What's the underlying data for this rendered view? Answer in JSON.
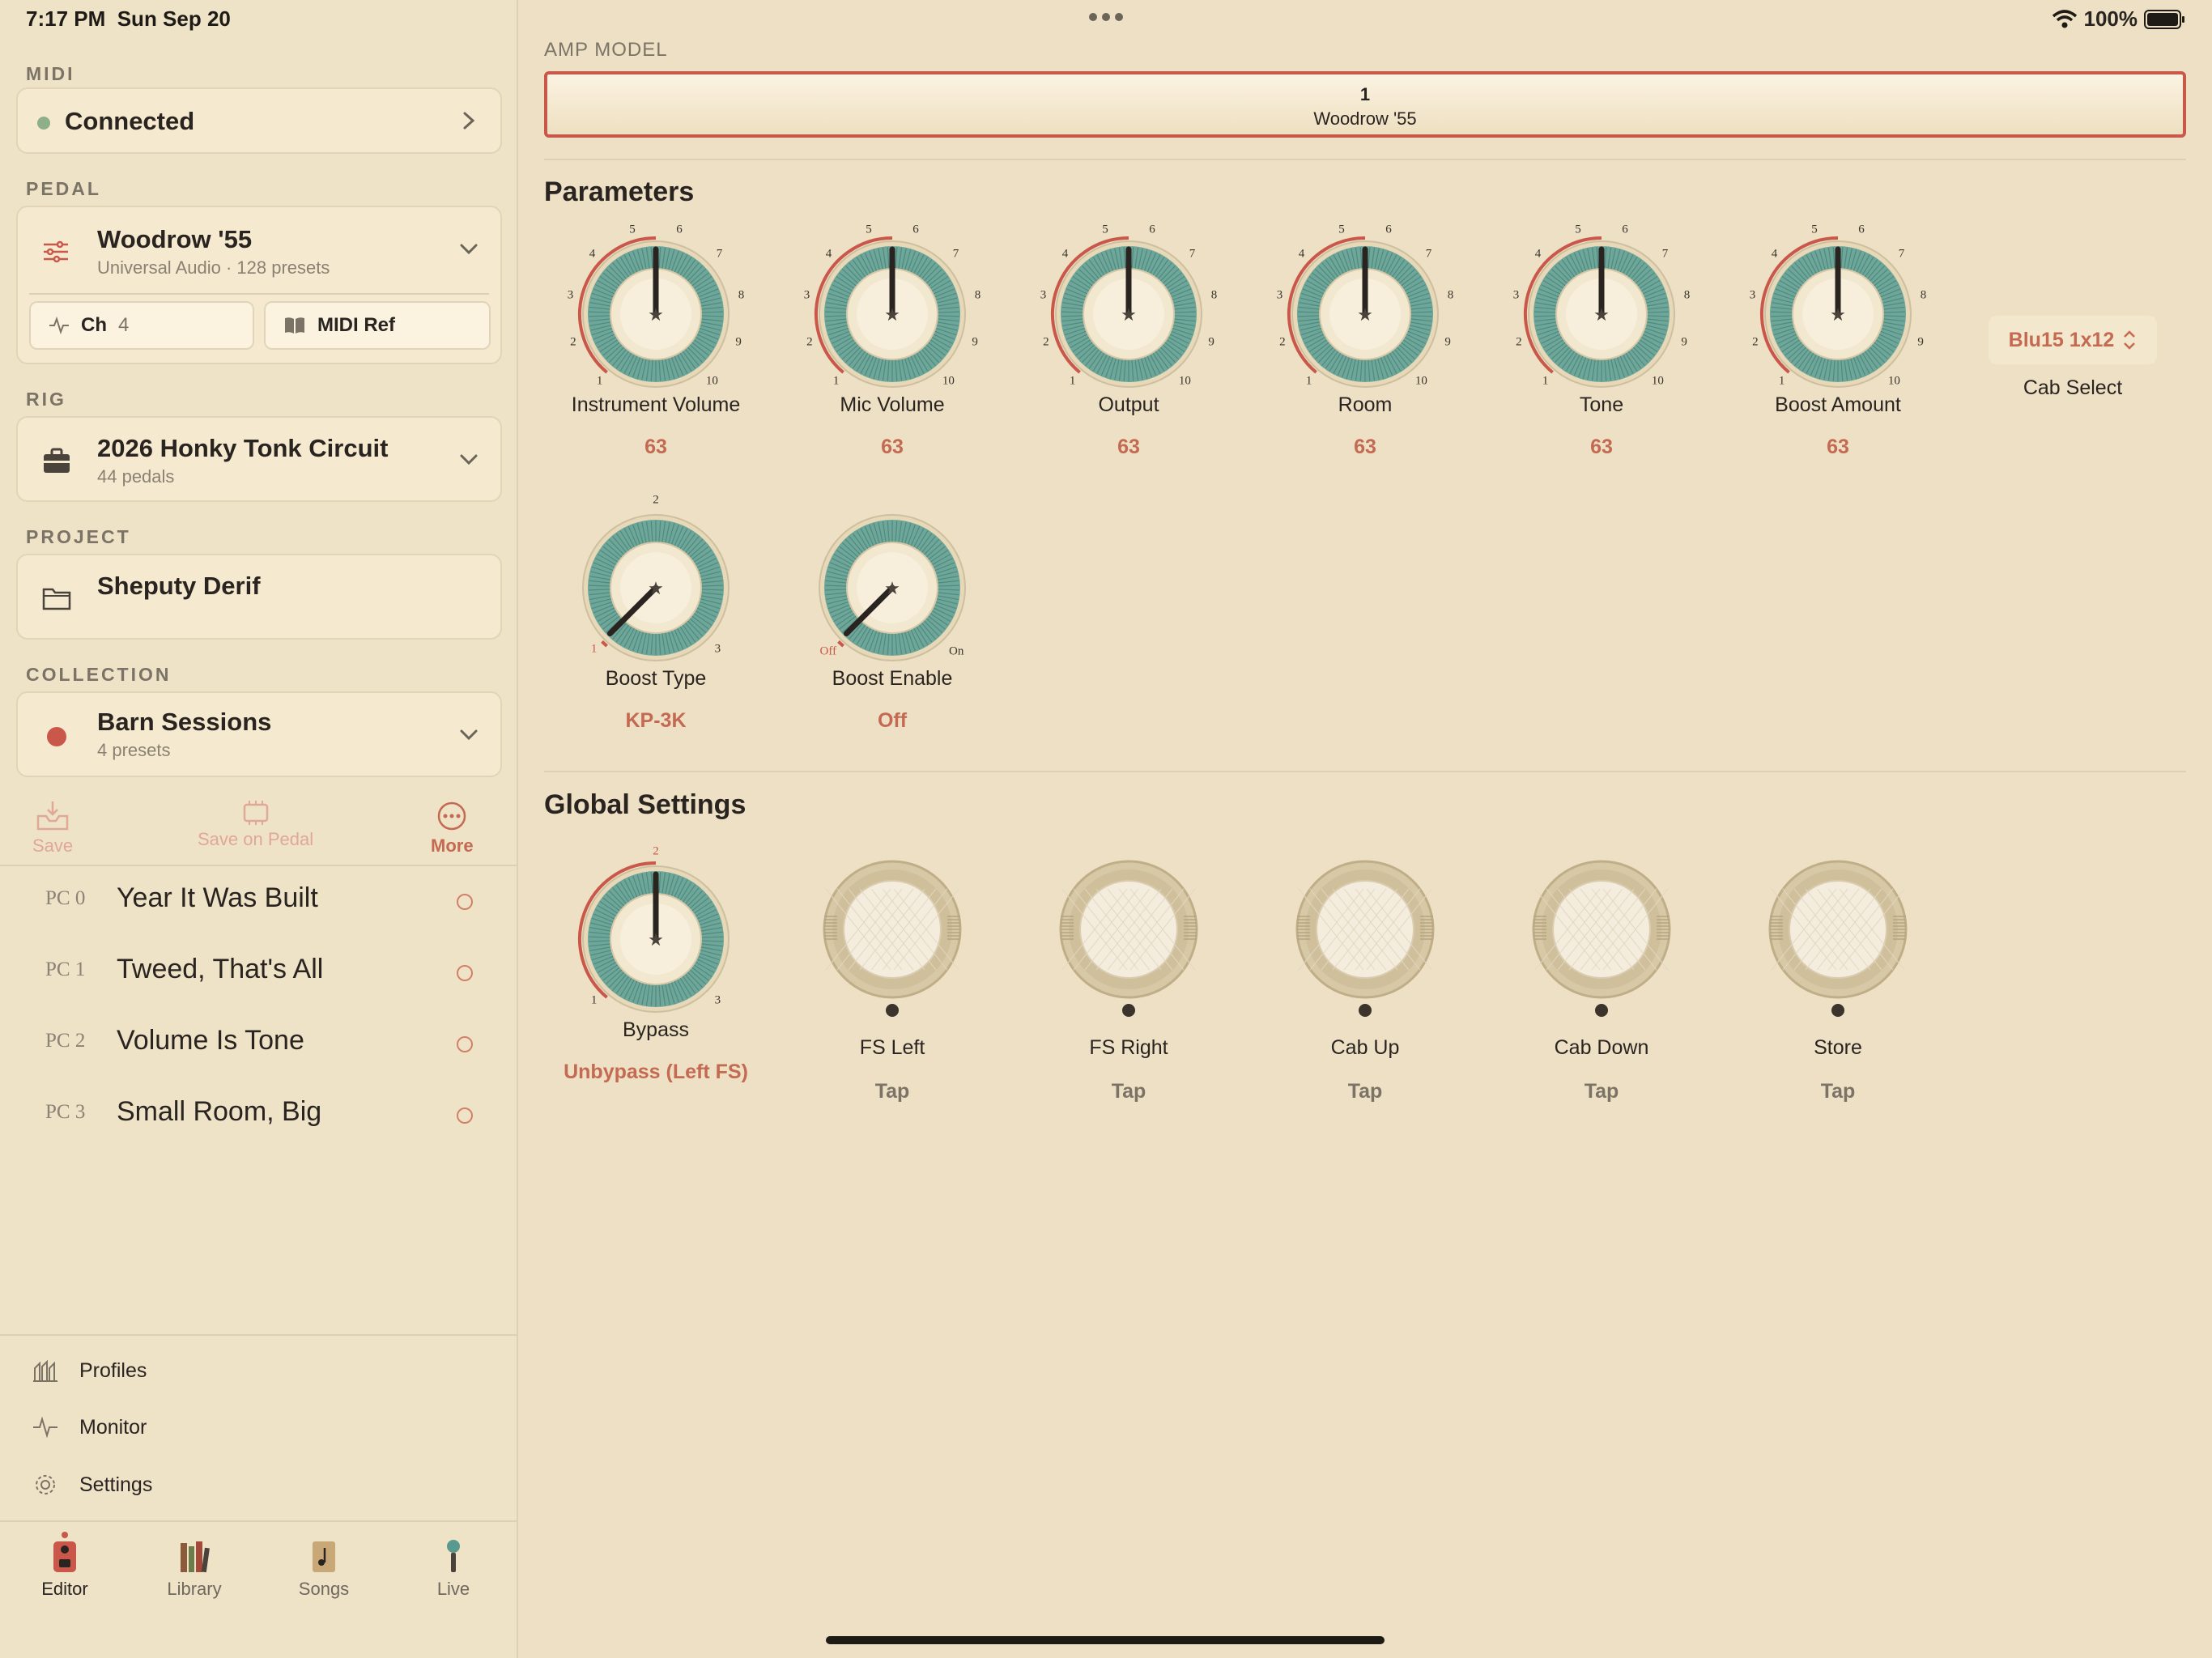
{
  "status": {
    "time": "7:17 PM",
    "date": "Sun Sep 20",
    "battery": "100%"
  },
  "sidebar": {
    "midi": {
      "label": "MIDI",
      "status": "Connected"
    },
    "pedal": {
      "label": "PEDAL",
      "name": "Woodrow '55",
      "sub": "Universal Audio · 128 presets",
      "channel_label": "Ch",
      "channel_value": "4",
      "midi_ref": "MIDI Ref"
    },
    "rig": {
      "label": "RIG",
      "name": "2026 Honky Tonk Circuit",
      "sub": "44 pedals"
    },
    "project": {
      "label": "PROJECT",
      "name": "Sheputy Derif"
    },
    "collection": {
      "label": "COLLECTION",
      "name": "Barn Sessions",
      "sub": "4 presets"
    },
    "toolbar": {
      "save": "Save",
      "save_on_pedal": "Save on Pedal",
      "more": "More"
    },
    "presets": [
      {
        "pc": "PC 0",
        "name": "Year It Was Built"
      },
      {
        "pc": "PC 1",
        "name": "Tweed, That's All"
      },
      {
        "pc": "PC 2",
        "name": "Volume Is Tone"
      },
      {
        "pc": "PC 3",
        "name": "Small Room, Big"
      }
    ],
    "nav": {
      "profiles": "Profiles",
      "monitor": "Monitor",
      "settings": "Settings"
    },
    "tabs": {
      "editor": "Editor",
      "library": "Library",
      "songs": "Songs",
      "live": "Live"
    }
  },
  "main": {
    "amp_model": {
      "label": "AMP MODEL",
      "number": "1",
      "name": "Woodrow '55"
    },
    "parameters_title": "Parameters",
    "knobs": [
      {
        "label": "Instrument Volume",
        "value": "63"
      },
      {
        "label": "Mic Volume",
        "value": "63"
      },
      {
        "label": "Output",
        "value": "63"
      },
      {
        "label": "Room",
        "value": "63"
      },
      {
        "label": "Tone",
        "value": "63"
      },
      {
        "label": "Boost Amount",
        "value": "63"
      }
    ],
    "scale_ticks": [
      "1",
      "2",
      "3",
      "4",
      "5",
      "6",
      "7",
      "8",
      "9",
      "10"
    ],
    "cab": {
      "value": "Blu15 1x12",
      "label": "Cab Select"
    },
    "boost_type": {
      "label": "Boost Type",
      "value": "KP-3K",
      "ticks": [
        "1",
        "2",
        "3"
      ]
    },
    "boost_enable": {
      "label": "Boost Enable",
      "value": "Off",
      "ticks": [
        "Off",
        "On"
      ]
    },
    "global_title": "Global Settings",
    "bypass": {
      "label": "Bypass",
      "value": "Unbypass (Left FS)",
      "ticks": [
        "1",
        "2",
        "3"
      ]
    },
    "footswitches": [
      {
        "label": "FS Left",
        "value": "Tap"
      },
      {
        "label": "FS Right",
        "value": "Tap"
      },
      {
        "label": "Cab Up",
        "value": "Tap"
      },
      {
        "label": "Cab Down",
        "value": "Tap"
      },
      {
        "label": "Store",
        "value": "Tap"
      }
    ]
  },
  "colors": {
    "accent": "#c46a52",
    "teal": "#6ea69a",
    "background": "#ede0c4",
    "connected": "#8fae8a",
    "record": "#c9574a"
  }
}
